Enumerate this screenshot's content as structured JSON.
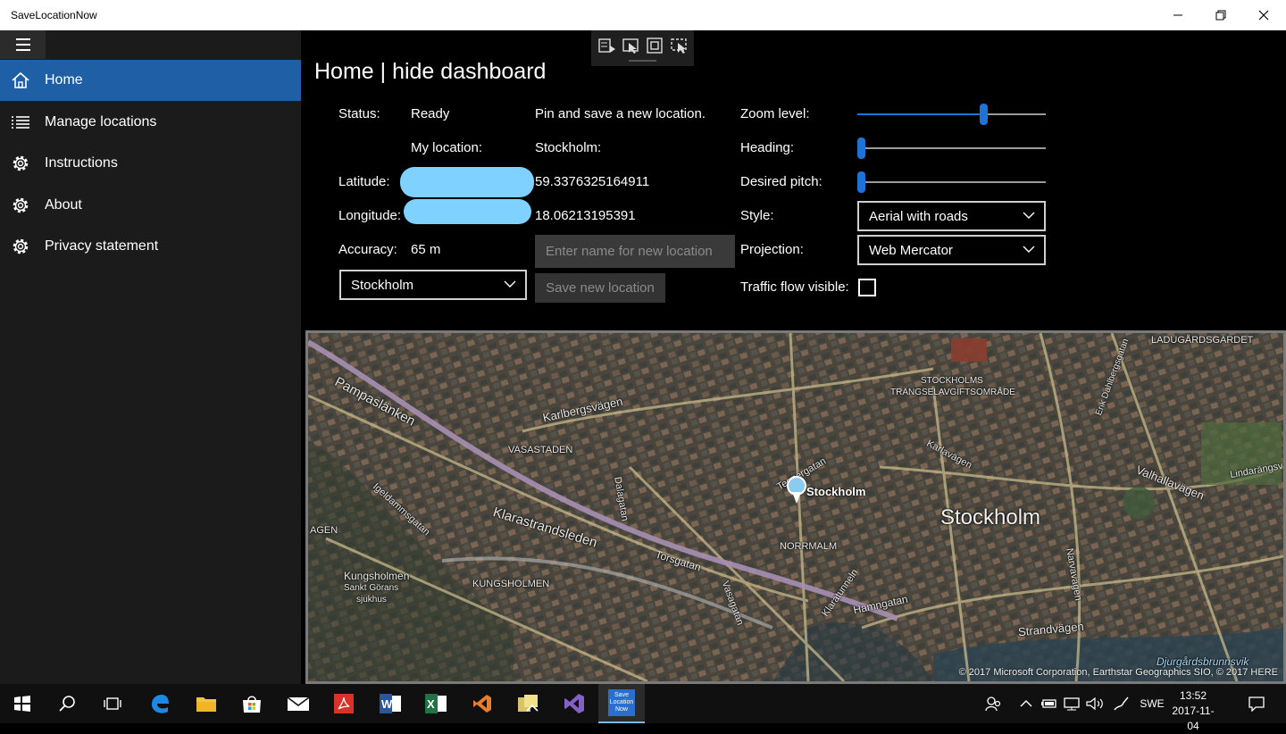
{
  "window": {
    "title": "SaveLocationNow",
    "minimize": "minimize",
    "restore": "restore",
    "close": "close"
  },
  "sidebar": {
    "items": [
      {
        "label": "Home",
        "icon": "home-icon",
        "active": true
      },
      {
        "label": "Manage locations",
        "icon": "list-icon"
      },
      {
        "label": "Instructions",
        "icon": "gear-icon"
      },
      {
        "label": "About",
        "icon": "gear-icon"
      },
      {
        "label": "Privacy statement",
        "icon": "gear-icon"
      }
    ]
  },
  "page": {
    "title": "Home | hide dashboard"
  },
  "status": {
    "status_label": "Status:",
    "status_value": "Ready",
    "my_location_label": "My location:",
    "my_location_value": "Stockholm:",
    "latitude_label": "Latitude:",
    "latitude_value": "59.3376325164911",
    "longitude_label": "Longitude:",
    "longitude_value": "18.06213195391",
    "accuracy_label": "Accuracy:",
    "accuracy_value": "65 m",
    "location_select": "Stockholm"
  },
  "save": {
    "prompt": "Pin and save a new location.",
    "name_placeholder": "Enter name for new location",
    "save_button": "Save new location"
  },
  "settings": {
    "zoom_label": "Zoom level:",
    "zoom_level": 0.68,
    "heading_label": "Heading:",
    "heading_level": 0.0,
    "pitch_label": "Desired pitch:",
    "pitch_level": 0.0,
    "style_label": "Style:",
    "style_value": "Aerial with roads",
    "projection_label": "Projection:",
    "projection_value": "Web Mercator",
    "traffic_label": "Traffic flow visible:",
    "traffic_checked": false
  },
  "map": {
    "labels": {
      "pampaslanken": "Pampaslänken",
      "karlbergsvagen": "Karlbergsvägen",
      "vasastaden": "VASASTADEN",
      "dalagatan": "Dalagatan",
      "tegnergatan": "Tegnérgatan",
      "pin": "Stockholm",
      "city": "Stockholm",
      "klarastrandsleden": "Klarastrandsleden",
      "torsgatan": "Torsgatan",
      "norrmalm": "NORRMALM",
      "kungsholmen_district": "KUNGSHOLMEN",
      "kungsholmen": "Kungsholmen",
      "sankt_gorans": "Sankt Görans",
      "sjukhus": "sjukhus",
      "vasagatan": "Vasagatan",
      "hamngatan": "Hamngatan",
      "strandvagen": "Strandvägen",
      "karlavagen": "Karlavägen",
      "valhallavagen": "Valhallavägen",
      "tunnel": "Klaratunneln",
      "ladugardsgardet": "LADUGÅRDSGÄRDET",
      "stockholms": "STOCKHOLMS",
      "trangselavgift": "TRÄNGSELAVGIFTSOMRÅDE",
      "igeldammsgatan": "Igeldammsgatan",
      "agen": "AGEN",
      "djurgardsbrunnsvik": "Djurgårdsbrunnsvik",
      "dahlbergsgatan": "Erik Dahlbergsgatan",
      "narvavagen": "Narvavägen",
      "lindarangsv": "Lindarängsv"
    },
    "copyright": "© 2017 Microsoft Corporation, Earthstar Geographics  SIO, © 2017 HERE"
  },
  "taskbar": {
    "items": [
      "windows-start",
      "search",
      "task-view",
      "edge",
      "file-explorer",
      "store",
      "mail",
      "acrobat",
      "word",
      "excel",
      "visual-studio-code",
      "photo-app",
      "visual-studio",
      "save-location-now"
    ],
    "app_tile": "Save Location Now",
    "language": "SWE",
    "time": "13:52",
    "date": "2017-11-04"
  },
  "colors": {
    "accent": "#1e5fa6",
    "slider": "#1e73d6",
    "redaction": "#7fd1ff"
  }
}
